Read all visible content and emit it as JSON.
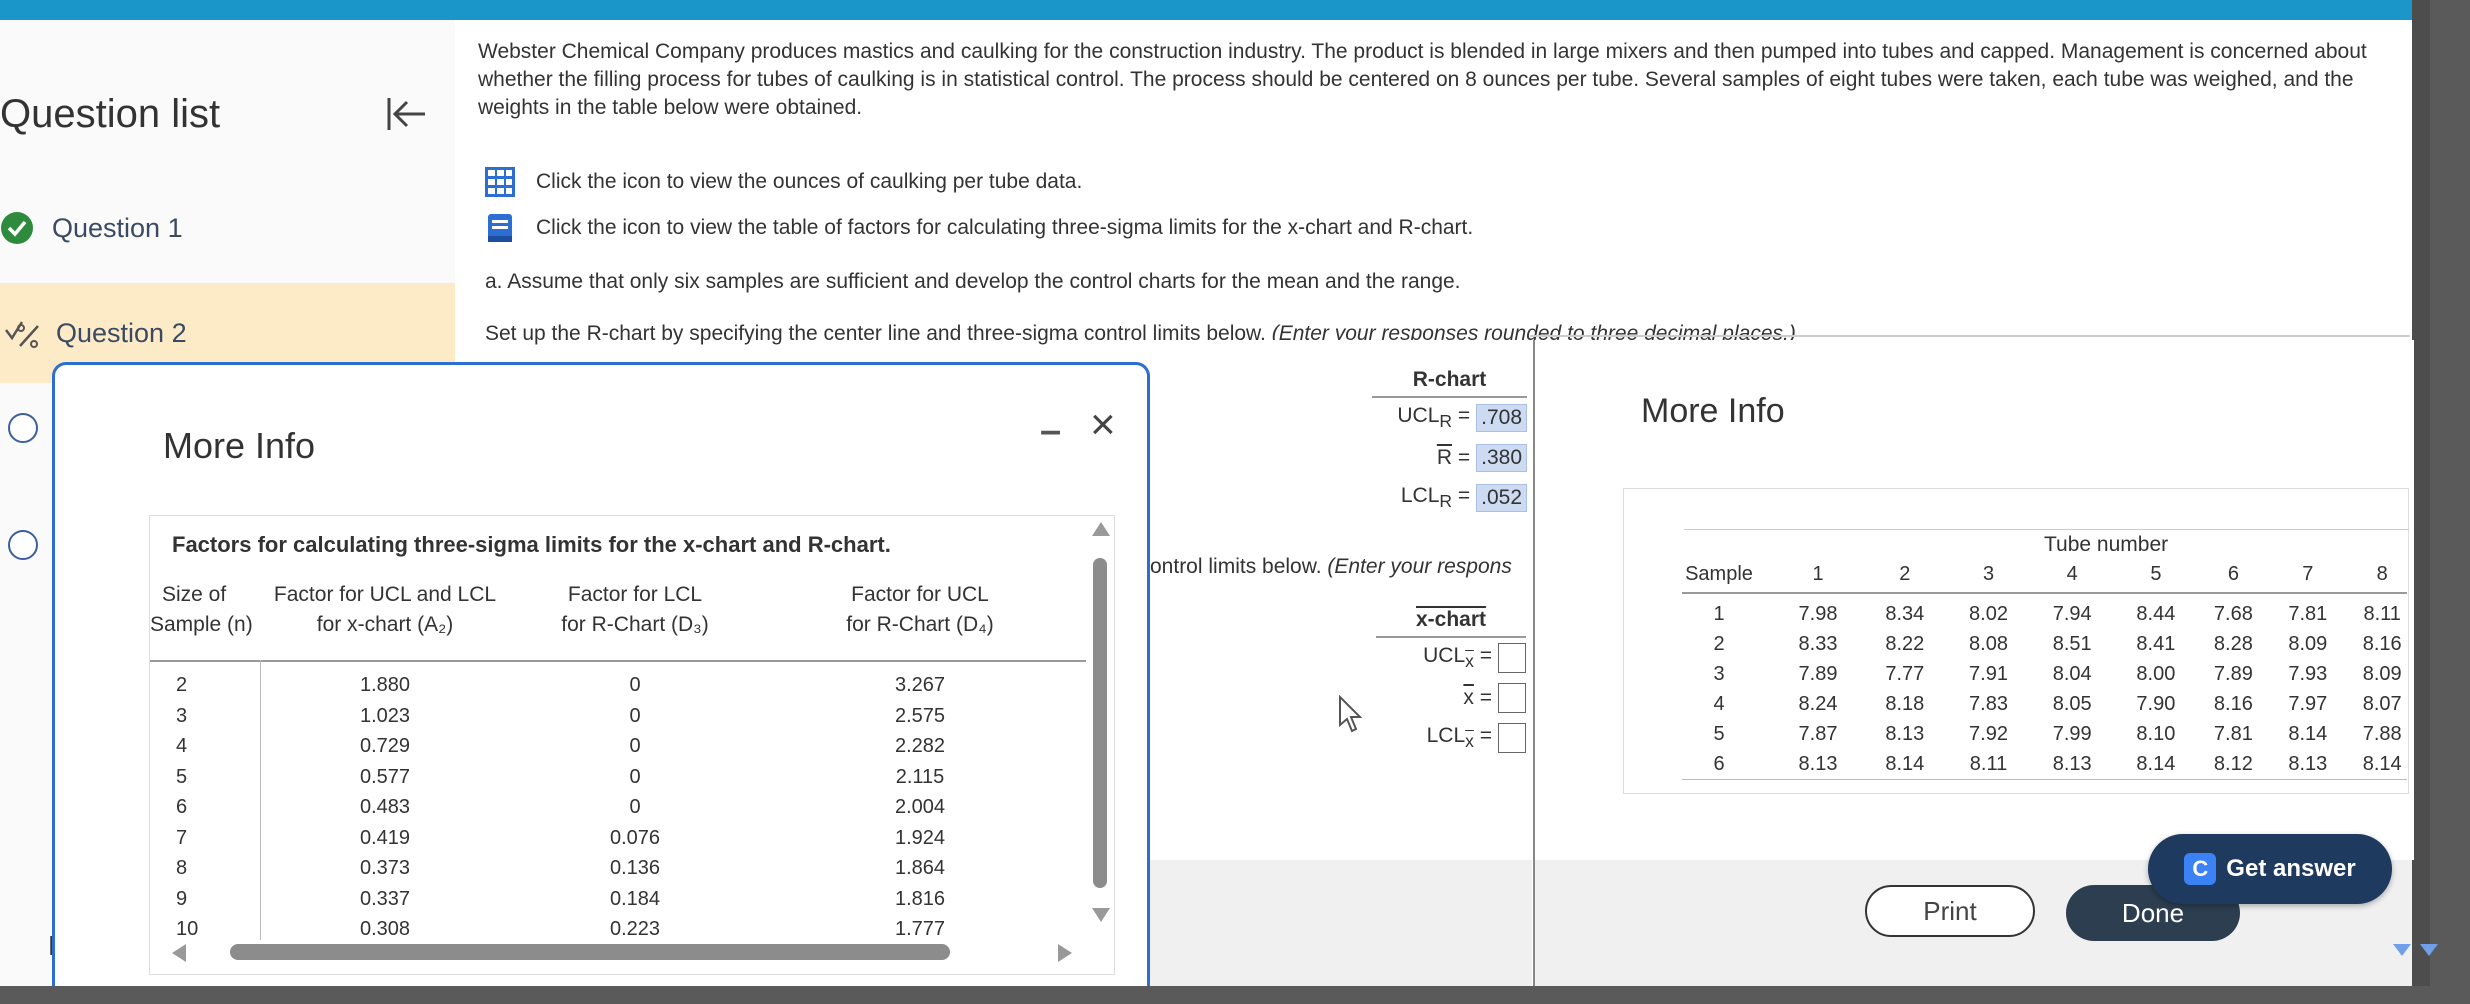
{
  "sidebar": {
    "title": "Question list",
    "items": [
      {
        "label": "Question 1"
      },
      {
        "label": "Question 2"
      }
    ],
    "bottom_letter": "E"
  },
  "problem": {
    "paragraph": "Webster Chemical Company produces mastics and caulking for the construction industry. The product is blended in large mixers and then pumped into tubes and capped. Management is concerned about whether the filling process for tubes of caulking is in statistical control. The process should be centered on 8 ounces per tube. Several samples of eight tubes were taken, each tube was weighed, and the weights in the table below were obtained.",
    "link1": "Click the icon to view the ounces of caulking per tube data.",
    "link2": "Click the icon to view the table of factors for calculating three-sigma limits for the x-chart and R-chart.",
    "part_a": "a. Assume that only six samples are sufficient and develop the control charts for the mean and the range.",
    "setup_prefix": "Set up the R-chart by specifying the center line and three-sigma control limits below. ",
    "setup_italic": "(Enter your responses rounded to three decimal places.)",
    "cut_text_prefix": "ontrol limits below. ",
    "cut_text_italic": "(Enter your respons"
  },
  "left_dialog": {
    "title": "More Info",
    "caption": "Factors for calculating three-sigma limits for the x-chart and R-chart.",
    "headers": {
      "n_l1": "Size of",
      "n_l2": "Sample (n)",
      "a2_l1": "Factor for UCL and LCL",
      "a2_l2": "for x-chart (A₂)",
      "d3_l1": "Factor for LCL",
      "d3_l2": "for R-Chart (D₃)",
      "d4_l1": "Factor for UCL",
      "d4_l2": "for R-Chart (D₄)"
    },
    "rows": [
      {
        "n": "2",
        "a2": "1.880",
        "d3": "0",
        "d4": "3.267"
      },
      {
        "n": "3",
        "a2": "1.023",
        "d3": "0",
        "d4": "2.575"
      },
      {
        "n": "4",
        "a2": "0.729",
        "d3": "0",
        "d4": "2.282"
      },
      {
        "n": "5",
        "a2": "0.577",
        "d3": "0",
        "d4": "2.115"
      },
      {
        "n": "6",
        "a2": "0.483",
        "d3": "0",
        "d4": "2.004"
      },
      {
        "n": "7",
        "a2": "0.419",
        "d3": "0.076",
        "d4": "1.924"
      },
      {
        "n": "8",
        "a2": "0.373",
        "d3": "0.136",
        "d4": "1.864"
      },
      {
        "n": "9",
        "a2": "0.337",
        "d3": "0.184",
        "d4": "1.816"
      },
      {
        "n": "10",
        "a2": "0.308",
        "d3": "0.223",
        "d4": "1.777"
      }
    ],
    "minimize": "–",
    "close": "×"
  },
  "rchart": {
    "title": "R-chart",
    "ucl_label": "UCL",
    "ucl_sub": "R",
    "ucl_value": ".708",
    "center_label": "R",
    "center_value": ".380",
    "lcl_label": "LCL",
    "lcl_sub": "R",
    "lcl_value": ".052"
  },
  "xchart": {
    "title": "x-chart",
    "ucl_label": "UCL",
    "ucl_sub": "x",
    "center_label": "x",
    "lcl_label": "LCL",
    "lcl_sub": "x"
  },
  "right_dialog": {
    "title": "More Info",
    "tube_title": "Tube number",
    "sample_header": "Sample",
    "columns": [
      "1",
      "2",
      "3",
      "4",
      "5",
      "6",
      "7",
      "8"
    ],
    "rows": [
      {
        "s": "1",
        "v": [
          "7.98",
          "8.34",
          "8.02",
          "7.94",
          "8.44",
          "7.68",
          "7.81",
          "8.11"
        ]
      },
      {
        "s": "2",
        "v": [
          "8.33",
          "8.22",
          "8.08",
          "8.51",
          "8.41",
          "8.28",
          "8.09",
          "8.16"
        ]
      },
      {
        "s": "3",
        "v": [
          "7.89",
          "7.77",
          "7.91",
          "8.04",
          "8.00",
          "7.89",
          "7.93",
          "8.09"
        ]
      },
      {
        "s": "4",
        "v": [
          "8.24",
          "8.18",
          "7.83",
          "8.05",
          "7.90",
          "8.16",
          "7.97",
          "8.07"
        ]
      },
      {
        "s": "5",
        "v": [
          "7.87",
          "8.13",
          "7.92",
          "7.99",
          "8.10",
          "7.81",
          "8.14",
          "7.88"
        ]
      },
      {
        "s": "6",
        "v": [
          "8.13",
          "8.14",
          "8.11",
          "8.13",
          "8.14",
          "8.12",
          "8.13",
          "8.14"
        ]
      }
    ]
  },
  "buttons": {
    "print": "Print",
    "done": "Done",
    "get_answer": "Get answer",
    "get_answer_icon": "C"
  },
  "colors": {
    "topbar": "#1a96c8",
    "accent_blue": "#2d6ed3",
    "highlight": "#fdebc8",
    "answer_box": "#ccdaf2",
    "done_bg": "#2c3e50"
  }
}
